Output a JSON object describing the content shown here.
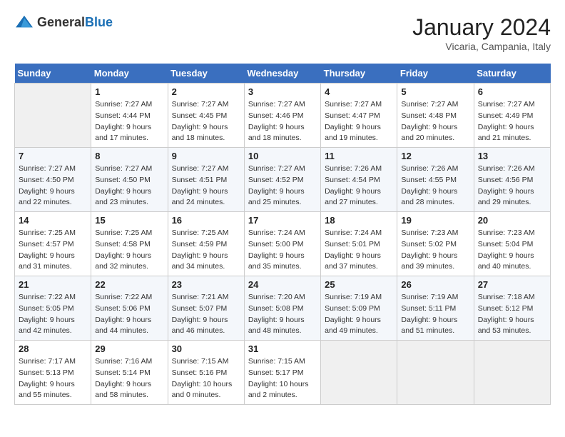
{
  "header": {
    "logo_general": "General",
    "logo_blue": "Blue",
    "month_year": "January 2024",
    "location": "Vicaria, Campania, Italy"
  },
  "days_of_week": [
    "Sunday",
    "Monday",
    "Tuesday",
    "Wednesday",
    "Thursday",
    "Friday",
    "Saturday"
  ],
  "weeks": [
    [
      {
        "day": "",
        "empty": true
      },
      {
        "day": "1",
        "sunrise": "Sunrise: 7:27 AM",
        "sunset": "Sunset: 4:44 PM",
        "daylight": "Daylight: 9 hours and 17 minutes."
      },
      {
        "day": "2",
        "sunrise": "Sunrise: 7:27 AM",
        "sunset": "Sunset: 4:45 PM",
        "daylight": "Daylight: 9 hours and 18 minutes."
      },
      {
        "day": "3",
        "sunrise": "Sunrise: 7:27 AM",
        "sunset": "Sunset: 4:46 PM",
        "daylight": "Daylight: 9 hours and 18 minutes."
      },
      {
        "day": "4",
        "sunrise": "Sunrise: 7:27 AM",
        "sunset": "Sunset: 4:47 PM",
        "daylight": "Daylight: 9 hours and 19 minutes."
      },
      {
        "day": "5",
        "sunrise": "Sunrise: 7:27 AM",
        "sunset": "Sunset: 4:48 PM",
        "daylight": "Daylight: 9 hours and 20 minutes."
      },
      {
        "day": "6",
        "sunrise": "Sunrise: 7:27 AM",
        "sunset": "Sunset: 4:49 PM",
        "daylight": "Daylight: 9 hours and 21 minutes."
      }
    ],
    [
      {
        "day": "7",
        "sunrise": "Sunrise: 7:27 AM",
        "sunset": "Sunset: 4:50 PM",
        "daylight": "Daylight: 9 hours and 22 minutes."
      },
      {
        "day": "8",
        "sunrise": "Sunrise: 7:27 AM",
        "sunset": "Sunset: 4:50 PM",
        "daylight": "Daylight: 9 hours and 23 minutes."
      },
      {
        "day": "9",
        "sunrise": "Sunrise: 7:27 AM",
        "sunset": "Sunset: 4:51 PM",
        "daylight": "Daylight: 9 hours and 24 minutes."
      },
      {
        "day": "10",
        "sunrise": "Sunrise: 7:27 AM",
        "sunset": "Sunset: 4:52 PM",
        "daylight": "Daylight: 9 hours and 25 minutes."
      },
      {
        "day": "11",
        "sunrise": "Sunrise: 7:26 AM",
        "sunset": "Sunset: 4:54 PM",
        "daylight": "Daylight: 9 hours and 27 minutes."
      },
      {
        "day": "12",
        "sunrise": "Sunrise: 7:26 AM",
        "sunset": "Sunset: 4:55 PM",
        "daylight": "Daylight: 9 hours and 28 minutes."
      },
      {
        "day": "13",
        "sunrise": "Sunrise: 7:26 AM",
        "sunset": "Sunset: 4:56 PM",
        "daylight": "Daylight: 9 hours and 29 minutes."
      }
    ],
    [
      {
        "day": "14",
        "sunrise": "Sunrise: 7:25 AM",
        "sunset": "Sunset: 4:57 PM",
        "daylight": "Daylight: 9 hours and 31 minutes."
      },
      {
        "day": "15",
        "sunrise": "Sunrise: 7:25 AM",
        "sunset": "Sunset: 4:58 PM",
        "daylight": "Daylight: 9 hours and 32 minutes."
      },
      {
        "day": "16",
        "sunrise": "Sunrise: 7:25 AM",
        "sunset": "Sunset: 4:59 PM",
        "daylight": "Daylight: 9 hours and 34 minutes."
      },
      {
        "day": "17",
        "sunrise": "Sunrise: 7:24 AM",
        "sunset": "Sunset: 5:00 PM",
        "daylight": "Daylight: 9 hours and 35 minutes."
      },
      {
        "day": "18",
        "sunrise": "Sunrise: 7:24 AM",
        "sunset": "Sunset: 5:01 PM",
        "daylight": "Daylight: 9 hours and 37 minutes."
      },
      {
        "day": "19",
        "sunrise": "Sunrise: 7:23 AM",
        "sunset": "Sunset: 5:02 PM",
        "daylight": "Daylight: 9 hours and 39 minutes."
      },
      {
        "day": "20",
        "sunrise": "Sunrise: 7:23 AM",
        "sunset": "Sunset: 5:04 PM",
        "daylight": "Daylight: 9 hours and 40 minutes."
      }
    ],
    [
      {
        "day": "21",
        "sunrise": "Sunrise: 7:22 AM",
        "sunset": "Sunset: 5:05 PM",
        "daylight": "Daylight: 9 hours and 42 minutes."
      },
      {
        "day": "22",
        "sunrise": "Sunrise: 7:22 AM",
        "sunset": "Sunset: 5:06 PM",
        "daylight": "Daylight: 9 hours and 44 minutes."
      },
      {
        "day": "23",
        "sunrise": "Sunrise: 7:21 AM",
        "sunset": "Sunset: 5:07 PM",
        "daylight": "Daylight: 9 hours and 46 minutes."
      },
      {
        "day": "24",
        "sunrise": "Sunrise: 7:20 AM",
        "sunset": "Sunset: 5:08 PM",
        "daylight": "Daylight: 9 hours and 48 minutes."
      },
      {
        "day": "25",
        "sunrise": "Sunrise: 7:19 AM",
        "sunset": "Sunset: 5:09 PM",
        "daylight": "Daylight: 9 hours and 49 minutes."
      },
      {
        "day": "26",
        "sunrise": "Sunrise: 7:19 AM",
        "sunset": "Sunset: 5:11 PM",
        "daylight": "Daylight: 9 hours and 51 minutes."
      },
      {
        "day": "27",
        "sunrise": "Sunrise: 7:18 AM",
        "sunset": "Sunset: 5:12 PM",
        "daylight": "Daylight: 9 hours and 53 minutes."
      }
    ],
    [
      {
        "day": "28",
        "sunrise": "Sunrise: 7:17 AM",
        "sunset": "Sunset: 5:13 PM",
        "daylight": "Daylight: 9 hours and 55 minutes."
      },
      {
        "day": "29",
        "sunrise": "Sunrise: 7:16 AM",
        "sunset": "Sunset: 5:14 PM",
        "daylight": "Daylight: 9 hours and 58 minutes."
      },
      {
        "day": "30",
        "sunrise": "Sunrise: 7:15 AM",
        "sunset": "Sunset: 5:16 PM",
        "daylight": "Daylight: 10 hours and 0 minutes."
      },
      {
        "day": "31",
        "sunrise": "Sunrise: 7:15 AM",
        "sunset": "Sunset: 5:17 PM",
        "daylight": "Daylight: 10 hours and 2 minutes."
      },
      {
        "day": "",
        "empty": true
      },
      {
        "day": "",
        "empty": true
      },
      {
        "day": "",
        "empty": true
      }
    ]
  ]
}
